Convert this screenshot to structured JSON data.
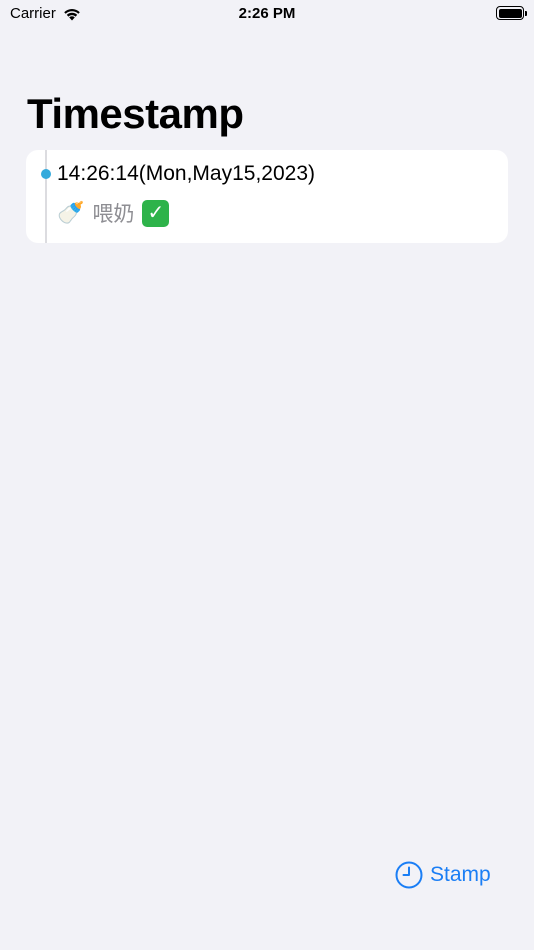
{
  "status_bar": {
    "carrier": "Carrier",
    "time": "2:26 PM",
    "wifi_icon": "wifi-icon",
    "battery_icon": "battery-full-icon"
  },
  "page": {
    "title": "Timestamp"
  },
  "entries": [
    {
      "time": "14:26:14(Mon,May15,2023)",
      "icon": "baby-bottle-icon",
      "label": "喂奶",
      "status_icon": "checkmark-icon"
    }
  ],
  "stamp_button": {
    "label": "Stamp",
    "icon": "clock-icon"
  },
  "colors": {
    "background": "#f2f2f7",
    "card": "#ffffff",
    "accent": "#1a7ef5",
    "timeline_dot": "#34aadc",
    "secondary_text": "#8e8e93",
    "check_green": "#2eb34a"
  }
}
